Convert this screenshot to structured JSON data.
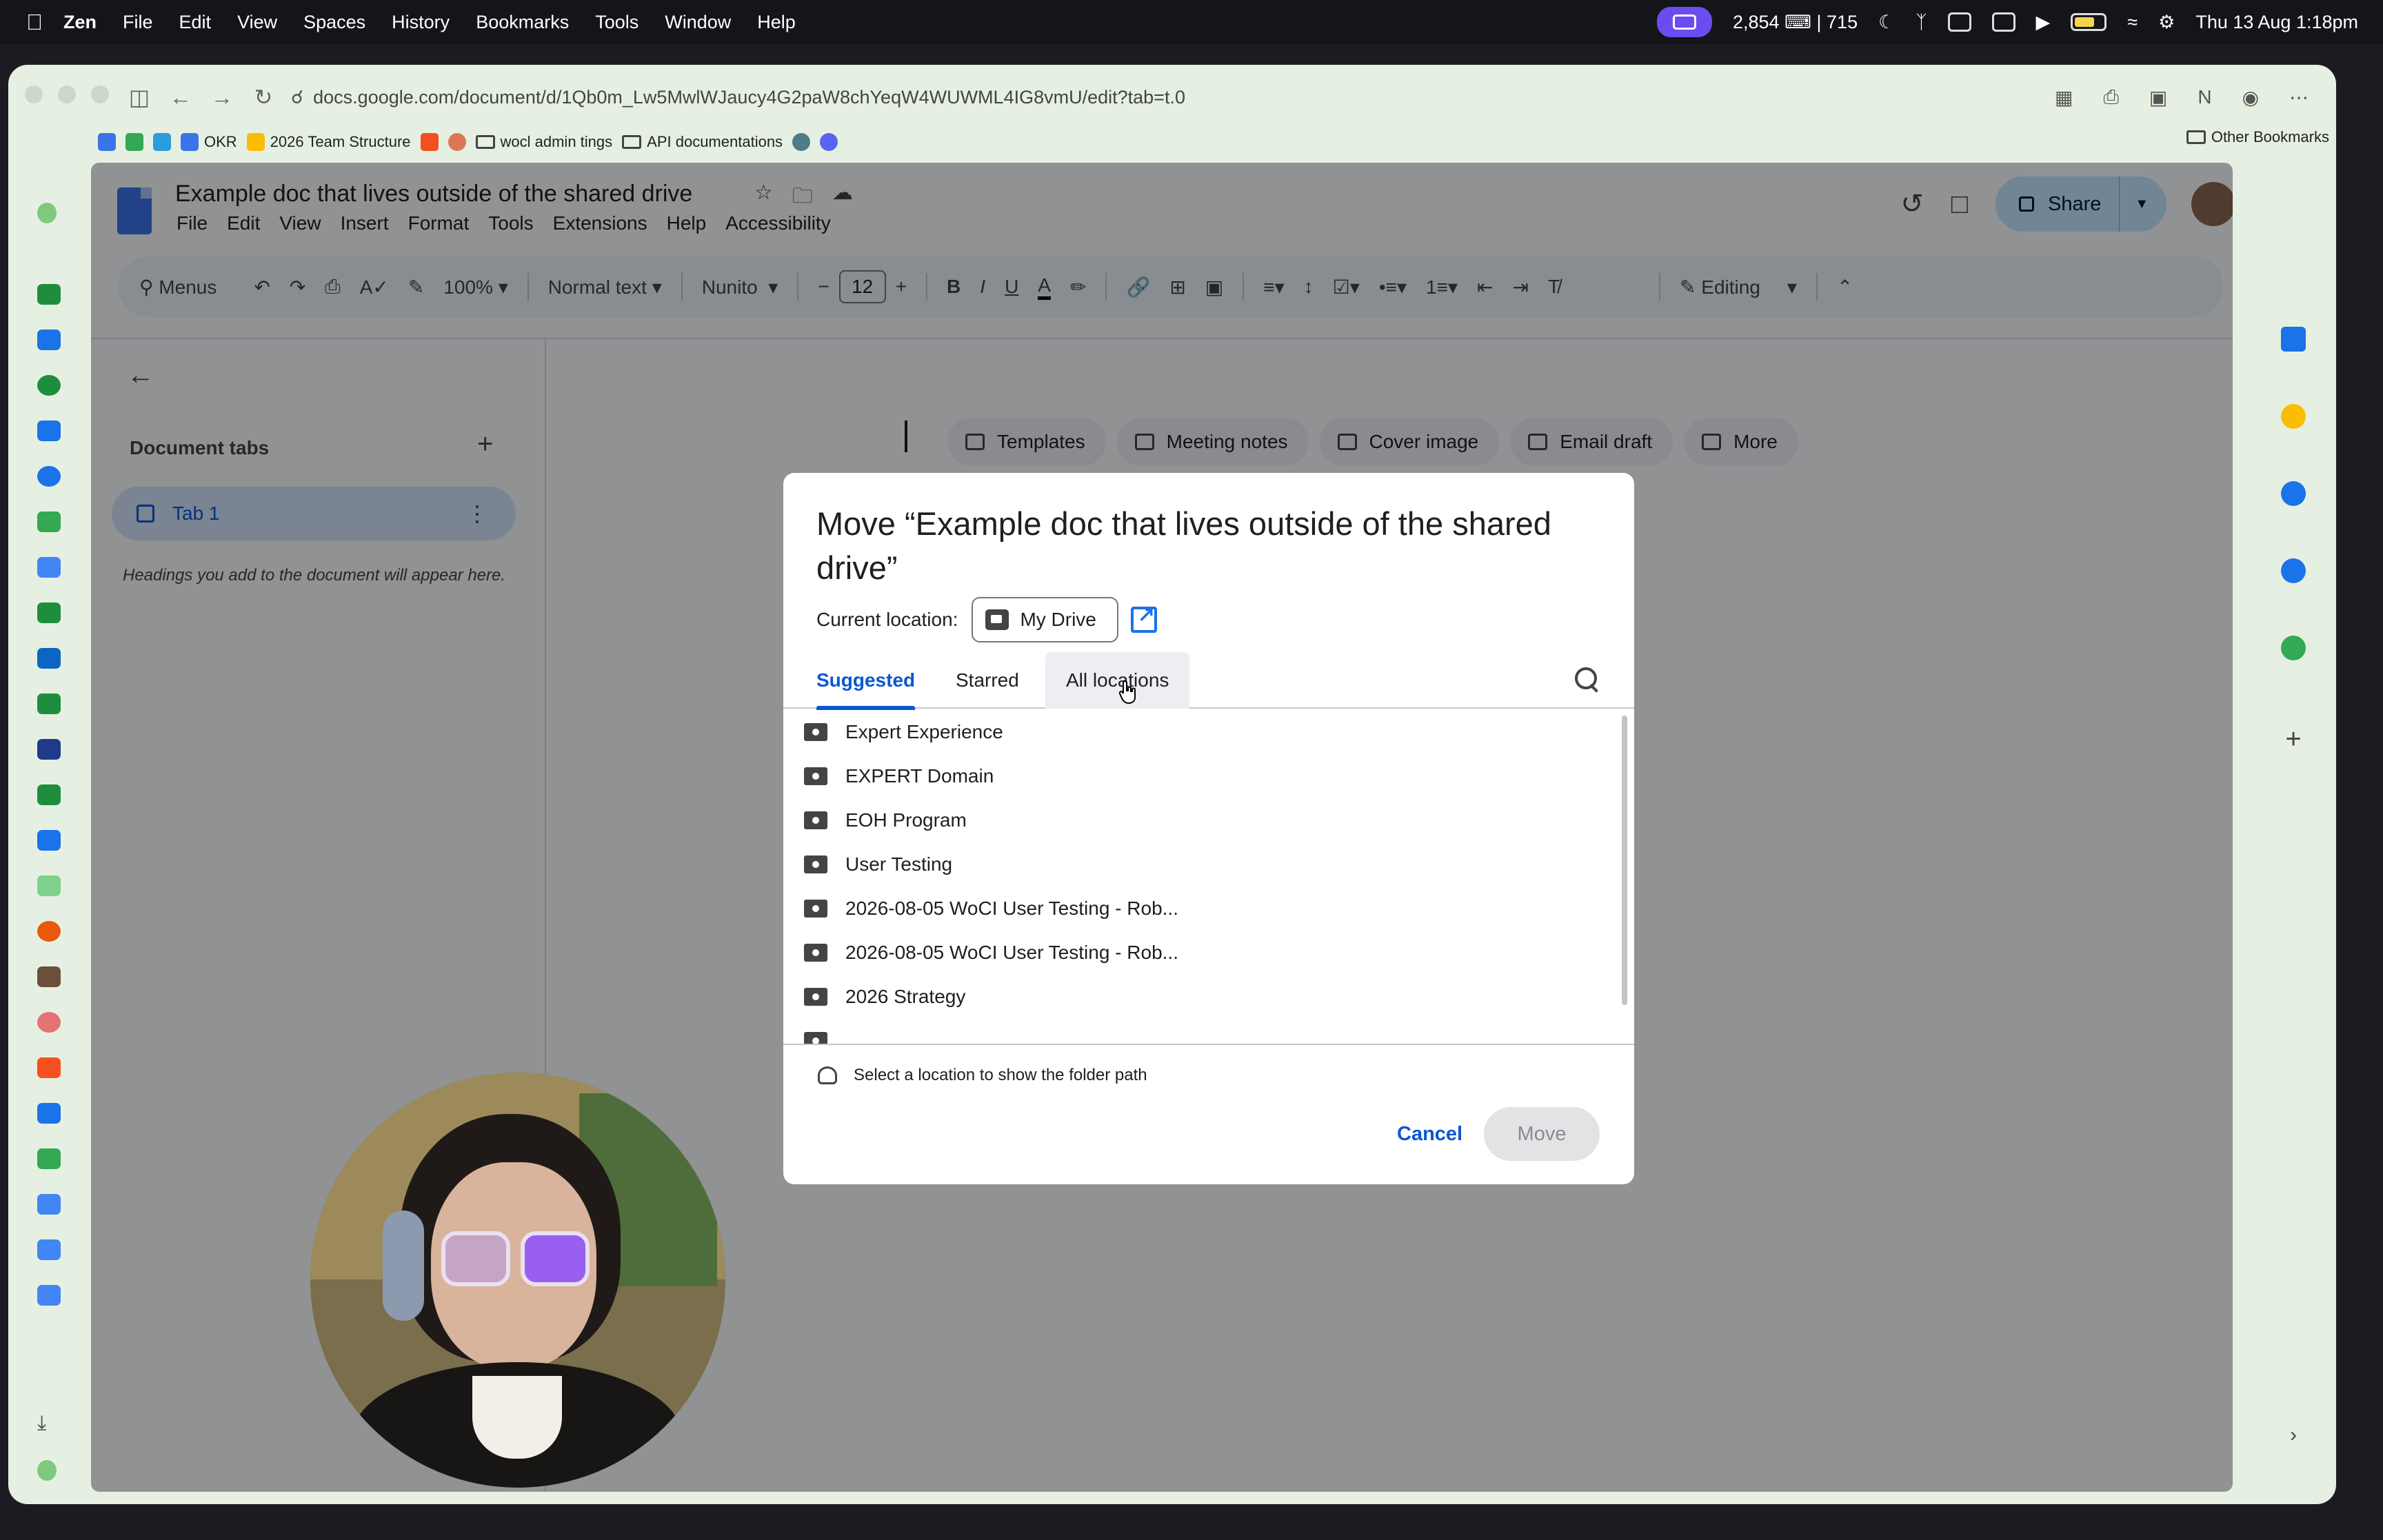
{
  "menubar": {
    "app": "Zen",
    "items": [
      "File",
      "Edit",
      "View",
      "Spaces",
      "History",
      "Bookmarks",
      "Tools",
      "Window",
      "Help"
    ],
    "status_counter": "2,854 ⌨ | 715",
    "datetime": "Thu 13 Aug  1:18pm"
  },
  "browser": {
    "url": "docs.google.com/document/d/1Qb0m_Lw5MwlWJaucy4G2paW8chYeqW4WUWML4IG8vmU/edit?tab=t.0",
    "bookmarks": [
      "OKR",
      "2026 Team Structure",
      "wocl admin tings",
      "API documentations"
    ],
    "other_bookmarks": "Other Bookmarks"
  },
  "doc": {
    "title": "Example doc that lives outside of the shared drive",
    "menu": [
      "File",
      "Edit",
      "View",
      "Insert",
      "Format",
      "Tools",
      "Extensions",
      "Help",
      "Accessibility"
    ],
    "share_label": "Share",
    "toolbar": {
      "menus": "Menus",
      "zoom": "100%",
      "style": "Normal text",
      "font": "Nunito",
      "font_size": "12",
      "mode": "Editing"
    },
    "outline": {
      "heading": "Document tabs",
      "tab_label": "Tab 1",
      "hint": "Headings you add to the document will appear here."
    },
    "chips": [
      "Templates",
      "Meeting notes",
      "Cover image",
      "Email draft",
      "More"
    ]
  },
  "modal": {
    "title": "Move “Example doc that lives outside of the shared drive”",
    "current_location_label": "Current location:",
    "current_location": "My Drive",
    "tabs": [
      "Suggested",
      "Starred",
      "All locations"
    ],
    "active_tab": "Suggested",
    "folders": [
      "Expert Experience",
      "EXPERT Domain",
      "EOH Program",
      "User Testing",
      "2026-08-05 WoCI User Testing - Rob...",
      "2026-08-05 WoCI User Testing - Rob...",
      "2026 Strategy"
    ],
    "path_hint": "Select a location to show the folder path",
    "cancel_label": "Cancel",
    "move_label": "Move"
  },
  "colors": {
    "accent": "#0b57d0",
    "share_bg": "#c2e7ff",
    "window_bg": "#e6f0e2"
  }
}
